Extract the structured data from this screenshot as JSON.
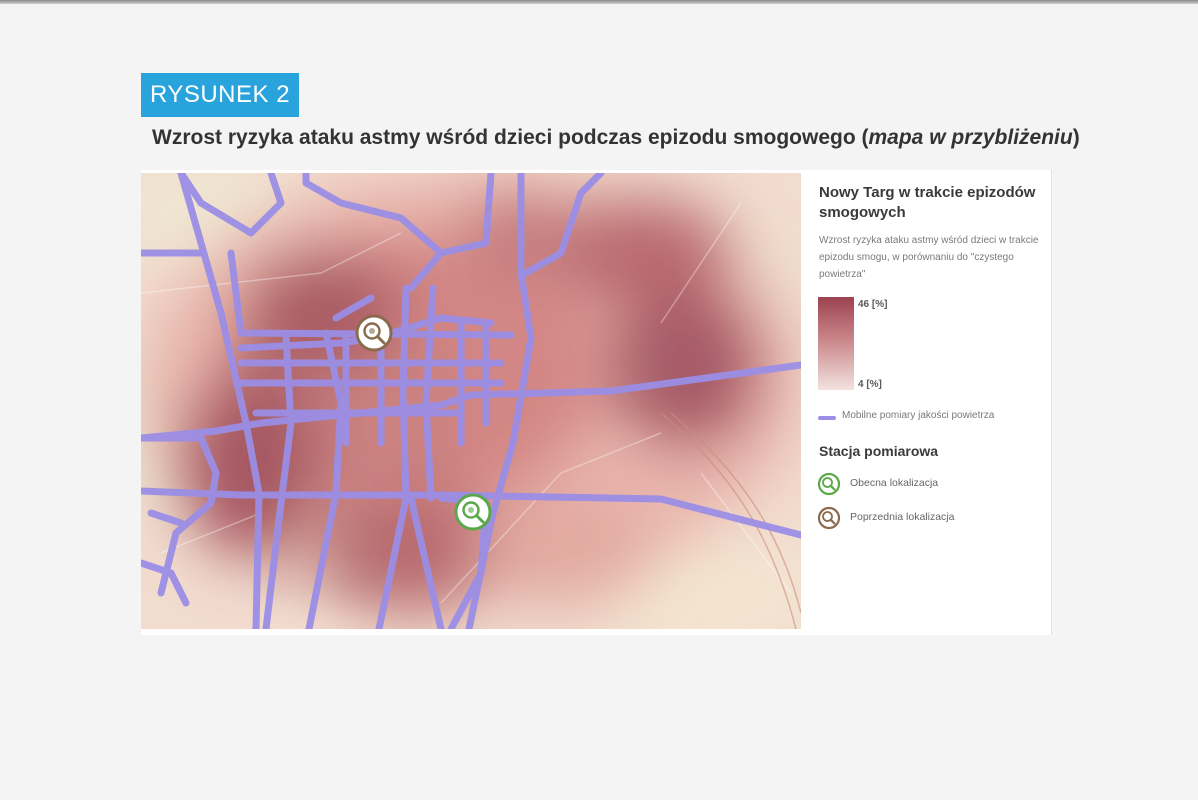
{
  "figure": {
    "label": "RYSUNEK 2",
    "title_main": "Wzrost ryzyka ataku astmy wśród dzieci podczas epizodu smogowego (",
    "title_italic": "mapa w przybliżeniu",
    "title_end": ")"
  },
  "legend": {
    "title": "Nowy Targ w trakcie epizodów smogowych",
    "subtitle": "Wzrost ryzyka ataku astmy wśród dzieci w trakcie epizodu smogu, w porównaniu do \"czystego powietrza\"",
    "scale_max": "46 [%]",
    "scale_min": "4 [%]",
    "scale_max_value": 46,
    "scale_min_value": 4,
    "route_label": "Mobilne pomiary jakości powietrza",
    "stations_title": "Stacja pomiarowa",
    "stations": [
      {
        "label": "Obecna lokalizacja",
        "color": "#5aa84a"
      },
      {
        "label": "Poprzednia lokalizacja",
        "color": "#8b6a4d"
      }
    ]
  },
  "colors": {
    "badge": "#29a3dc",
    "route": "#9b8ee6",
    "risk_high": "#9c4250",
    "risk_low": "#f3e2df"
  },
  "map": {
    "markers": [
      {
        "type": "previous-location",
        "icon": "magnifier-icon"
      },
      {
        "type": "current-location",
        "icon": "magnifier-icon"
      }
    ]
  }
}
